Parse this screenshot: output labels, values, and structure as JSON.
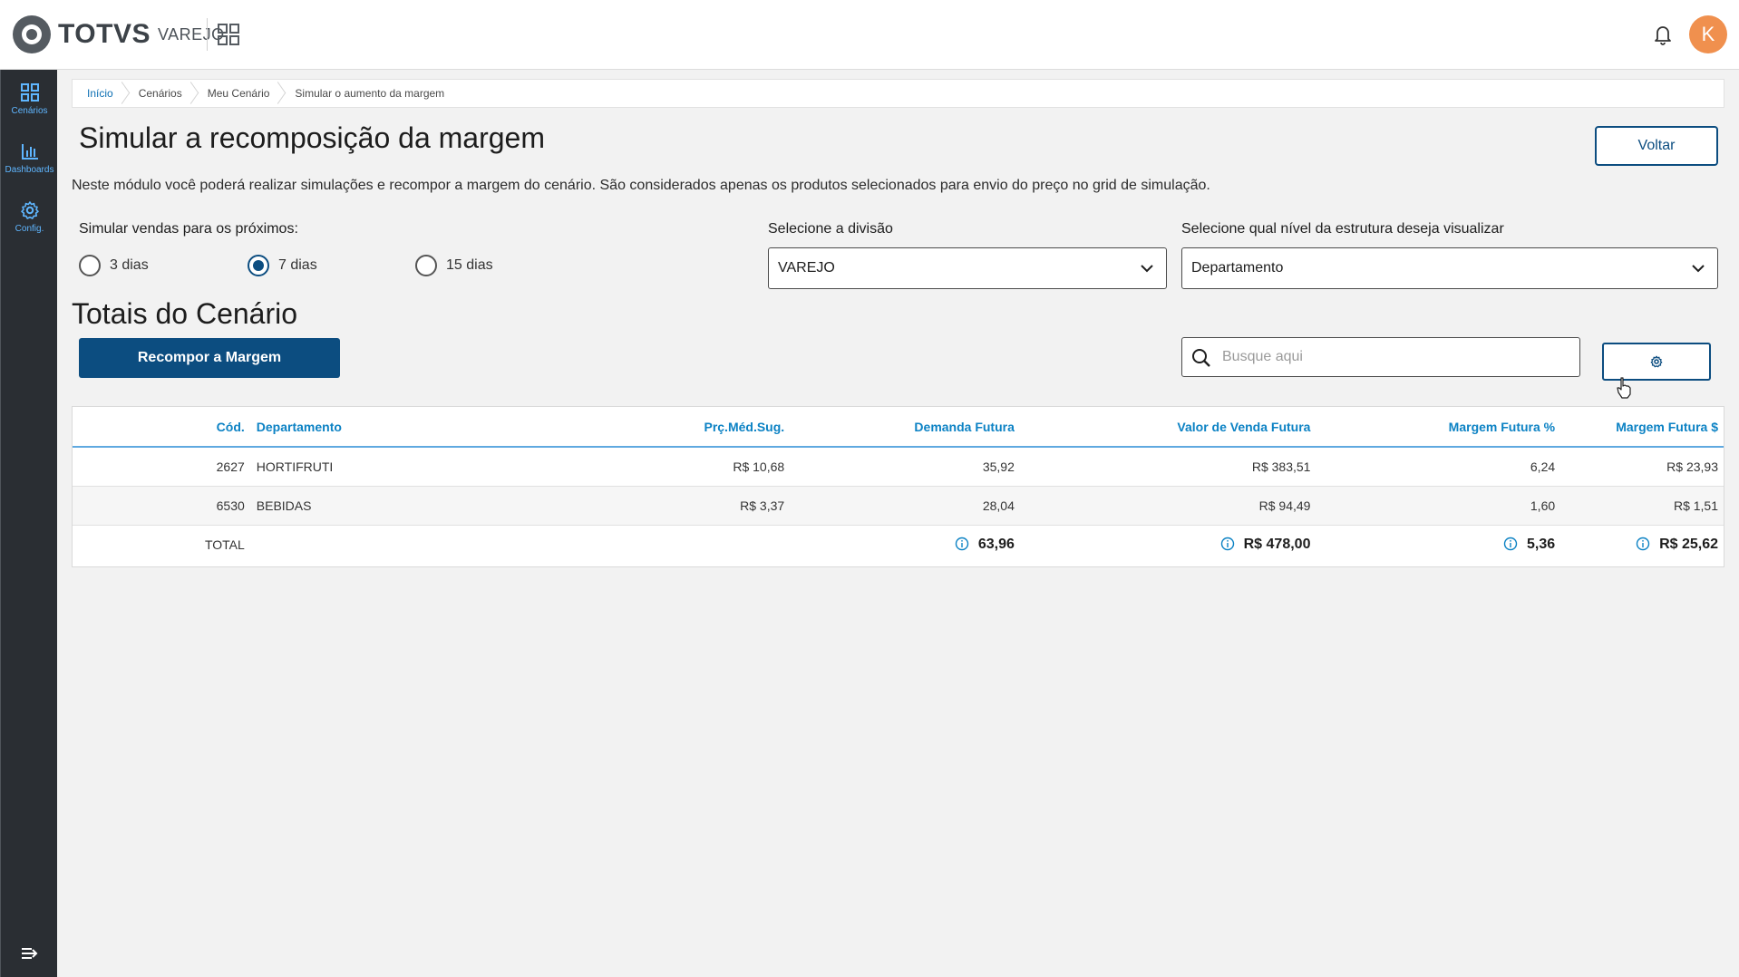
{
  "header": {
    "brand": "TOTVS",
    "product": "VAREJO",
    "avatar_initial": "K",
    "accent": "#f0904e"
  },
  "sidebar": {
    "items": [
      {
        "label": "Cenários",
        "icon": "grid-icon"
      },
      {
        "label": "Dashboards",
        "icon": "bar-chart-icon"
      },
      {
        "label": "Config.",
        "icon": "gear-icon"
      }
    ]
  },
  "breadcrumb": [
    "Início",
    "Cenários",
    "Meu Cenário",
    "Simular o aumento da margem"
  ],
  "page": {
    "title": "Simular a recomposição da margem",
    "back_label": "Voltar",
    "description": "Neste módulo você poderá realizar simulações e recompor a margem do cenário. São considerados apenas os produtos selecionados para envio do preço no grid de simulação."
  },
  "simulation": {
    "label": "Simular vendas para os próximos:",
    "options": [
      "3 dias",
      "7 dias",
      "15 dias"
    ],
    "selected": "7 dias"
  },
  "division": {
    "label": "Selecione a divisão",
    "value": "VAREJO"
  },
  "structure": {
    "label": "Selecione qual nível da estrutura deseja visualizar",
    "value": "Departamento"
  },
  "totals": {
    "title": "Totais do Cenário",
    "recompose_label": "Recompor a Margem",
    "search_placeholder": "Busque aqui"
  },
  "table": {
    "columns": [
      "Cód.",
      "Departamento",
      "Prç.Méd.Sug.",
      "Demanda Futura",
      "Valor de Venda Futura",
      "Margem Futura %",
      "Margem Futura $"
    ],
    "rows": [
      {
        "cod": "2627",
        "dept": "HORTIFRUTI",
        "preco": "R$ 10,68",
        "demanda": "35,92",
        "valor": "R$ 383,51",
        "margem_pct": "6,24",
        "margem_val": "R$ 23,93"
      },
      {
        "cod": "6530",
        "dept": "BEBIDAS",
        "preco": "R$ 3,37",
        "demanda": "28,04",
        "valor": "R$ 94,49",
        "margem_pct": "1,60",
        "margem_val": "R$ 1,51"
      }
    ],
    "total": {
      "label": "TOTAL",
      "demanda": "63,96",
      "valor": "R$ 478,00",
      "margem_pct": "5,36",
      "margem_val": "R$ 25,62"
    }
  },
  "colors": {
    "primary": "#0c4d80",
    "link": "#0c82c4",
    "sidebar_bg": "#2a2e33",
    "sidebar_accent": "#5fb6ff"
  }
}
